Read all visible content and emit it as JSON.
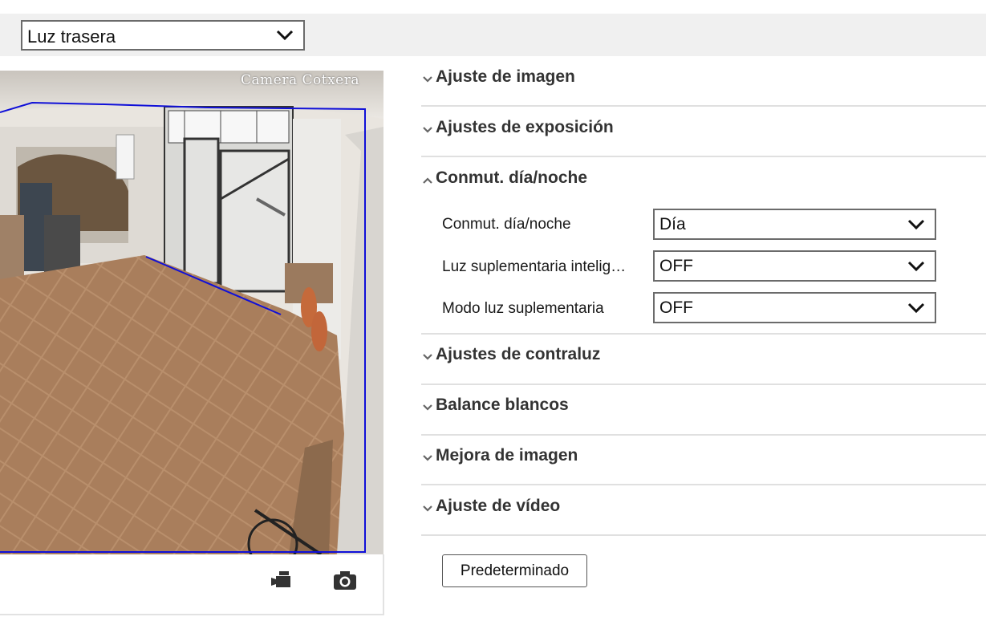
{
  "channel_select": {
    "value": "Luz trasera"
  },
  "video": {
    "osd_text": "Camera Cotxera"
  },
  "toolbar": {
    "record_icon": "video-record-icon",
    "snapshot_icon": "camera-snapshot-icon"
  },
  "sections": [
    {
      "title": "Ajuste de imagen",
      "expanded": false
    },
    {
      "title": "Ajustes de exposición",
      "expanded": false
    },
    {
      "title": "Conmut. día/noche",
      "expanded": true
    },
    {
      "title": "Ajustes de contraluz",
      "expanded": false
    },
    {
      "title": "Balance blancos",
      "expanded": false
    },
    {
      "title": "Mejora de imagen",
      "expanded": false
    },
    {
      "title": "Ajuste de vídeo",
      "expanded": false
    }
  ],
  "day_night": {
    "fields": [
      {
        "label": "Conmut. día/noche",
        "value": "Día"
      },
      {
        "label": "Luz suplementaria intelig…",
        "value": "OFF"
      },
      {
        "label": "Modo luz suplementaria",
        "value": "OFF"
      }
    ]
  },
  "default_button": {
    "label": "Predeterminado"
  },
  "colors": {
    "roi_line": "#1010d8",
    "divider": "#e0e0e0",
    "topbar_bg": "#f0f0f0"
  }
}
